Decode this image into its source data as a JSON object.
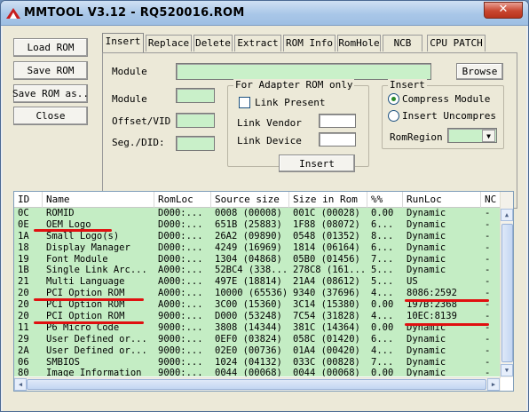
{
  "window": {
    "title": "MMTOOL V3.12 - RQ520016.ROM",
    "close_label": "✕"
  },
  "left_buttons": {
    "load": "Load ROM",
    "save": "Save ROM",
    "save_as": "Save ROM as..",
    "close": "Close"
  },
  "tabs": [
    {
      "label": "Insert",
      "active": true
    },
    {
      "label": "Replace"
    },
    {
      "label": "Delete"
    },
    {
      "label": "Extract"
    },
    {
      "label": "ROM Info"
    },
    {
      "label": "RomHole"
    },
    {
      "label": "NCB"
    },
    {
      "label": "CPU PATCH"
    }
  ],
  "insert_form": {
    "module_file_label": "Module",
    "browse_label": "Browse",
    "module_label": "Module",
    "offset_label": "Offset/VID",
    "seg_label": "Seg./DID:",
    "adapter_group_title": "For Adapter ROM only",
    "link_present_label": "Link Present",
    "link_vendor_label": "Link Vendor",
    "link_device_label": "Link Device",
    "insert_group_title": "Insert",
    "compress_label": "Compress Module",
    "uncompress_label": "Insert Uncompres",
    "romregion_label": "RomRegion",
    "insert_button": "Insert"
  },
  "table": {
    "columns": [
      "ID",
      "Name",
      "RomLoc",
      "Source size",
      "Size in Rom",
      "%%",
      "RunLoc",
      "NC"
    ],
    "rows": [
      [
        "0C",
        "ROMID",
        "D000:...",
        "0008 (00008)",
        "001C (00028)",
        "0.00",
        "Dynamic",
        "-"
      ],
      [
        "0E",
        "OEM Logo",
        "D000:...",
        "651B (25883)",
        "1F88 (08072)",
        "6...",
        "Dynamic",
        "-"
      ],
      [
        "1A",
        "Small Logo(s)",
        "D000:...",
        "26A2 (09890)",
        "0548 (01352)",
        "8...",
        "Dynamic",
        "-"
      ],
      [
        "18",
        "Display Manager",
        "D000:...",
        "4249 (16969)",
        "1814 (06164)",
        "6...",
        "Dynamic",
        "-"
      ],
      [
        "19",
        "Font Module",
        "D000:...",
        "1304 (04868)",
        "05B0 (01456)",
        "7...",
        "Dynamic",
        "-"
      ],
      [
        "1B",
        "Single Link Arc...",
        "A000:...",
        "52BC4 (338...",
        "278C8 (161...",
        "5...",
        "Dynamic",
        "-"
      ],
      [
        "21",
        "Multi Language",
        "A000:...",
        "497E (18814)",
        "21A4 (08612)",
        "5...",
        "US",
        "-"
      ],
      [
        "20",
        "PCI Option ROM",
        "A000:...",
        "10000 (65536)",
        "9340 (37696)",
        "4...",
        "8086:2592",
        "-"
      ],
      [
        "20",
        "PCI Option ROM",
        "A000:...",
        "3C00 (15360)",
        "3C14 (15380)",
        "0.00",
        "197B:2368",
        "-"
      ],
      [
        "20",
        "PCI Option ROM",
        "9000:...",
        "D000 (53248)",
        "7C54 (31828)",
        "4...",
        "10EC:8139",
        "-"
      ],
      [
        "11",
        "P6 Micro Code",
        "9000:...",
        "3808 (14344)",
        "381C (14364)",
        "0.00",
        "Dynamic",
        "-"
      ],
      [
        "29",
        "User Defined or...",
        "9000:...",
        "0EF0 (03824)",
        "058C (01420)",
        "6...",
        "Dynamic",
        "-"
      ],
      [
        "2A",
        "User Defined or...",
        "9000:...",
        "02E0 (00736)",
        "01A4 (00420)",
        "4...",
        "Dynamic",
        "-"
      ],
      [
        "06",
        "SMBIOS",
        "9000:...",
        "1024 (04132)",
        "033C (00828)",
        "7...",
        "Dynamic",
        "-"
      ],
      [
        "80",
        "Image Information",
        "9000:...",
        "0044 (00068)",
        "0044 (00068)",
        "0.00",
        "Dynamic",
        "-"
      ]
    ]
  },
  "colors": {
    "field_green": "#c9f0c9",
    "row_green": "#c4edc4",
    "annotation_red": "#e01010"
  }
}
